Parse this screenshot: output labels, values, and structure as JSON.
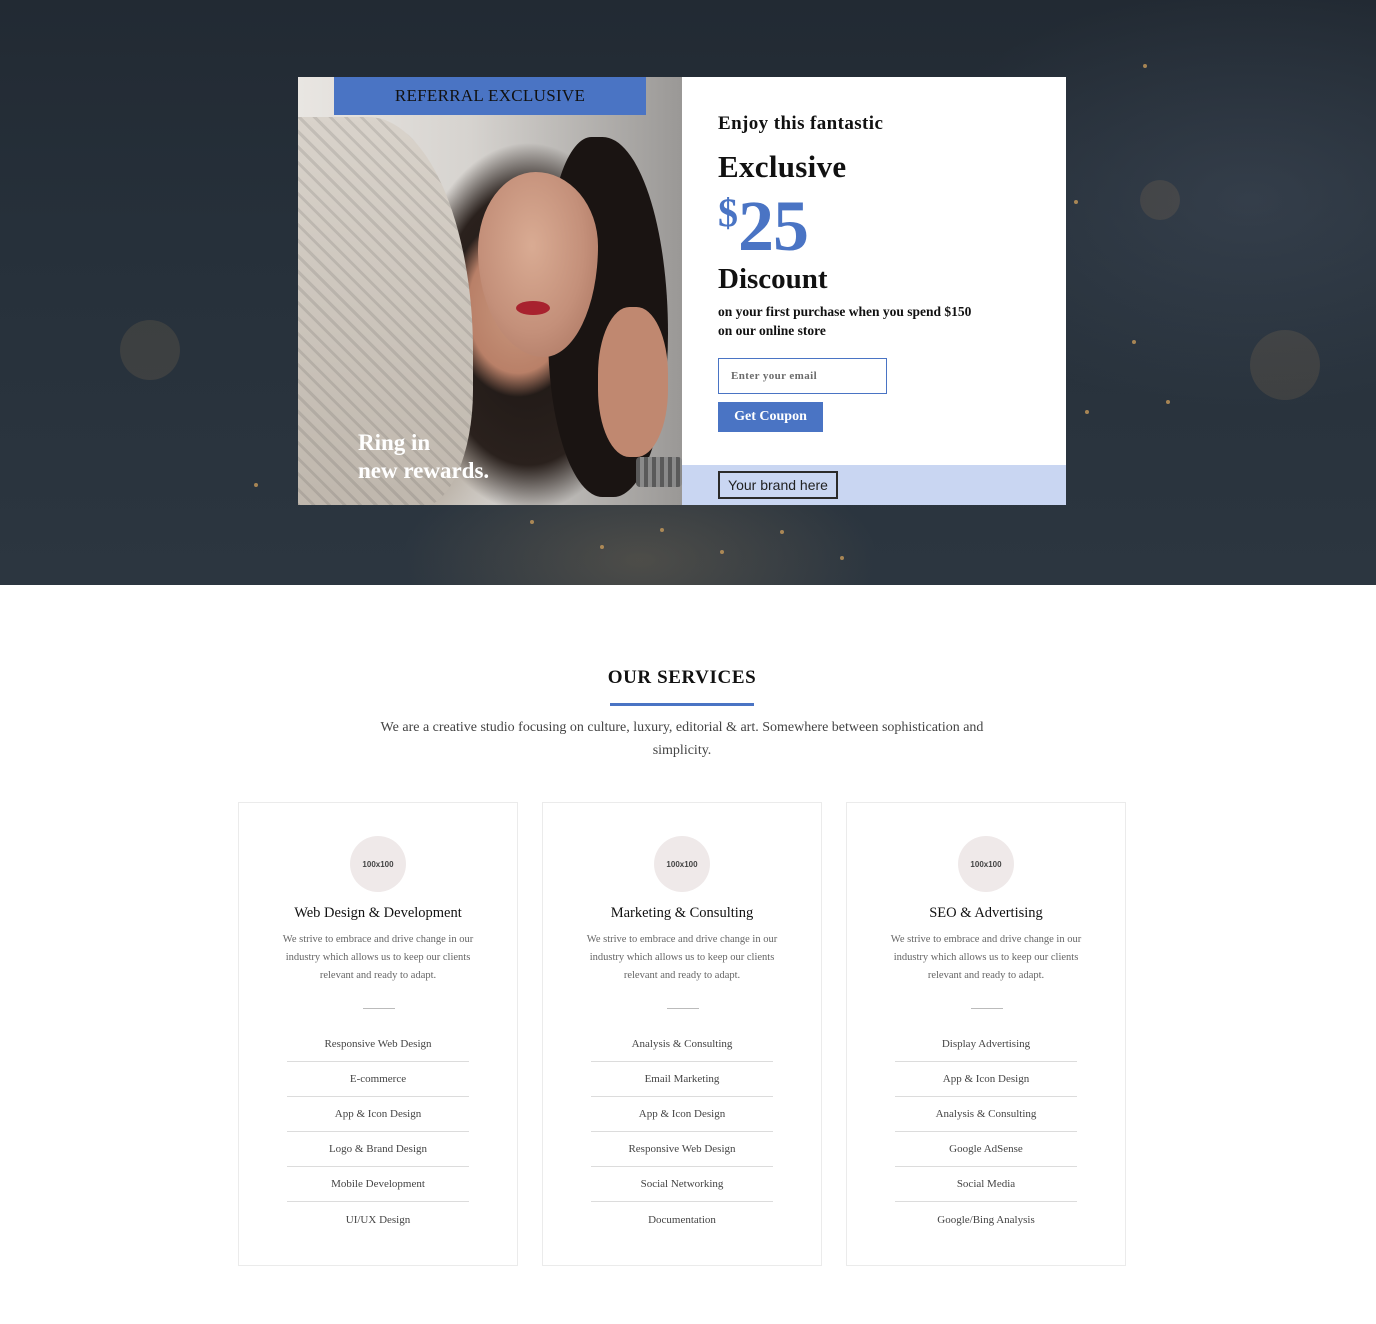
{
  "promo": {
    "badge": "REFERRAL EXCLUSIVE",
    "photo_caption_line1": "Ring in",
    "photo_caption_line2": "new rewards.",
    "eyebrow": "Enjoy this fantastic",
    "headline": "Exclusive",
    "currency": "$",
    "amount": "25",
    "discount": "Discount",
    "fine_line1": "on your first purchase when you spend $150",
    "fine_line2": "on our online store",
    "email_placeholder": "Enter your email",
    "coupon_label": "Get Coupon",
    "brand_label": "Your brand here",
    "accent_color": "#4a74c4",
    "brandbar_color": "#c9d6f2"
  },
  "services": {
    "title": "OUR SERVICES",
    "intro_line1": "We are a creative studio focusing on culture, luxury, editorial & art. Somewhere between sophistication and",
    "intro_line2": "simplicity.",
    "cards": [
      {
        "icon_label": "100x100",
        "title": "Web Design & Development",
        "description": "We strive to embrace and drive change in our industry which allows us to keep our clients relevant and ready to adapt.",
        "items": [
          "Responsive Web Design",
          "E-commerce",
          "App & Icon Design",
          "Logo & Brand Design",
          "Mobile Development",
          "UI/UX Design"
        ]
      },
      {
        "icon_label": "100x100",
        "title": "Marketing & Consulting",
        "description": "We strive to embrace and drive change in our industry which allows us to keep our clients relevant and ready to adapt.",
        "items": [
          "Analysis & Consulting",
          "Email Marketing",
          "App & Icon Design",
          "Responsive Web Design",
          "Social Networking",
          "Documentation"
        ]
      },
      {
        "icon_label": "100x100",
        "title": "SEO & Advertising",
        "description": "We strive to embrace and drive change in our industry which allows us to keep our clients relevant and ready to adapt.",
        "items": [
          "Display Advertising",
          "App & Icon Design",
          "Analysis & Consulting",
          "Google AdSense",
          "Social Media",
          "Google/Bing Analysis"
        ]
      }
    ]
  }
}
